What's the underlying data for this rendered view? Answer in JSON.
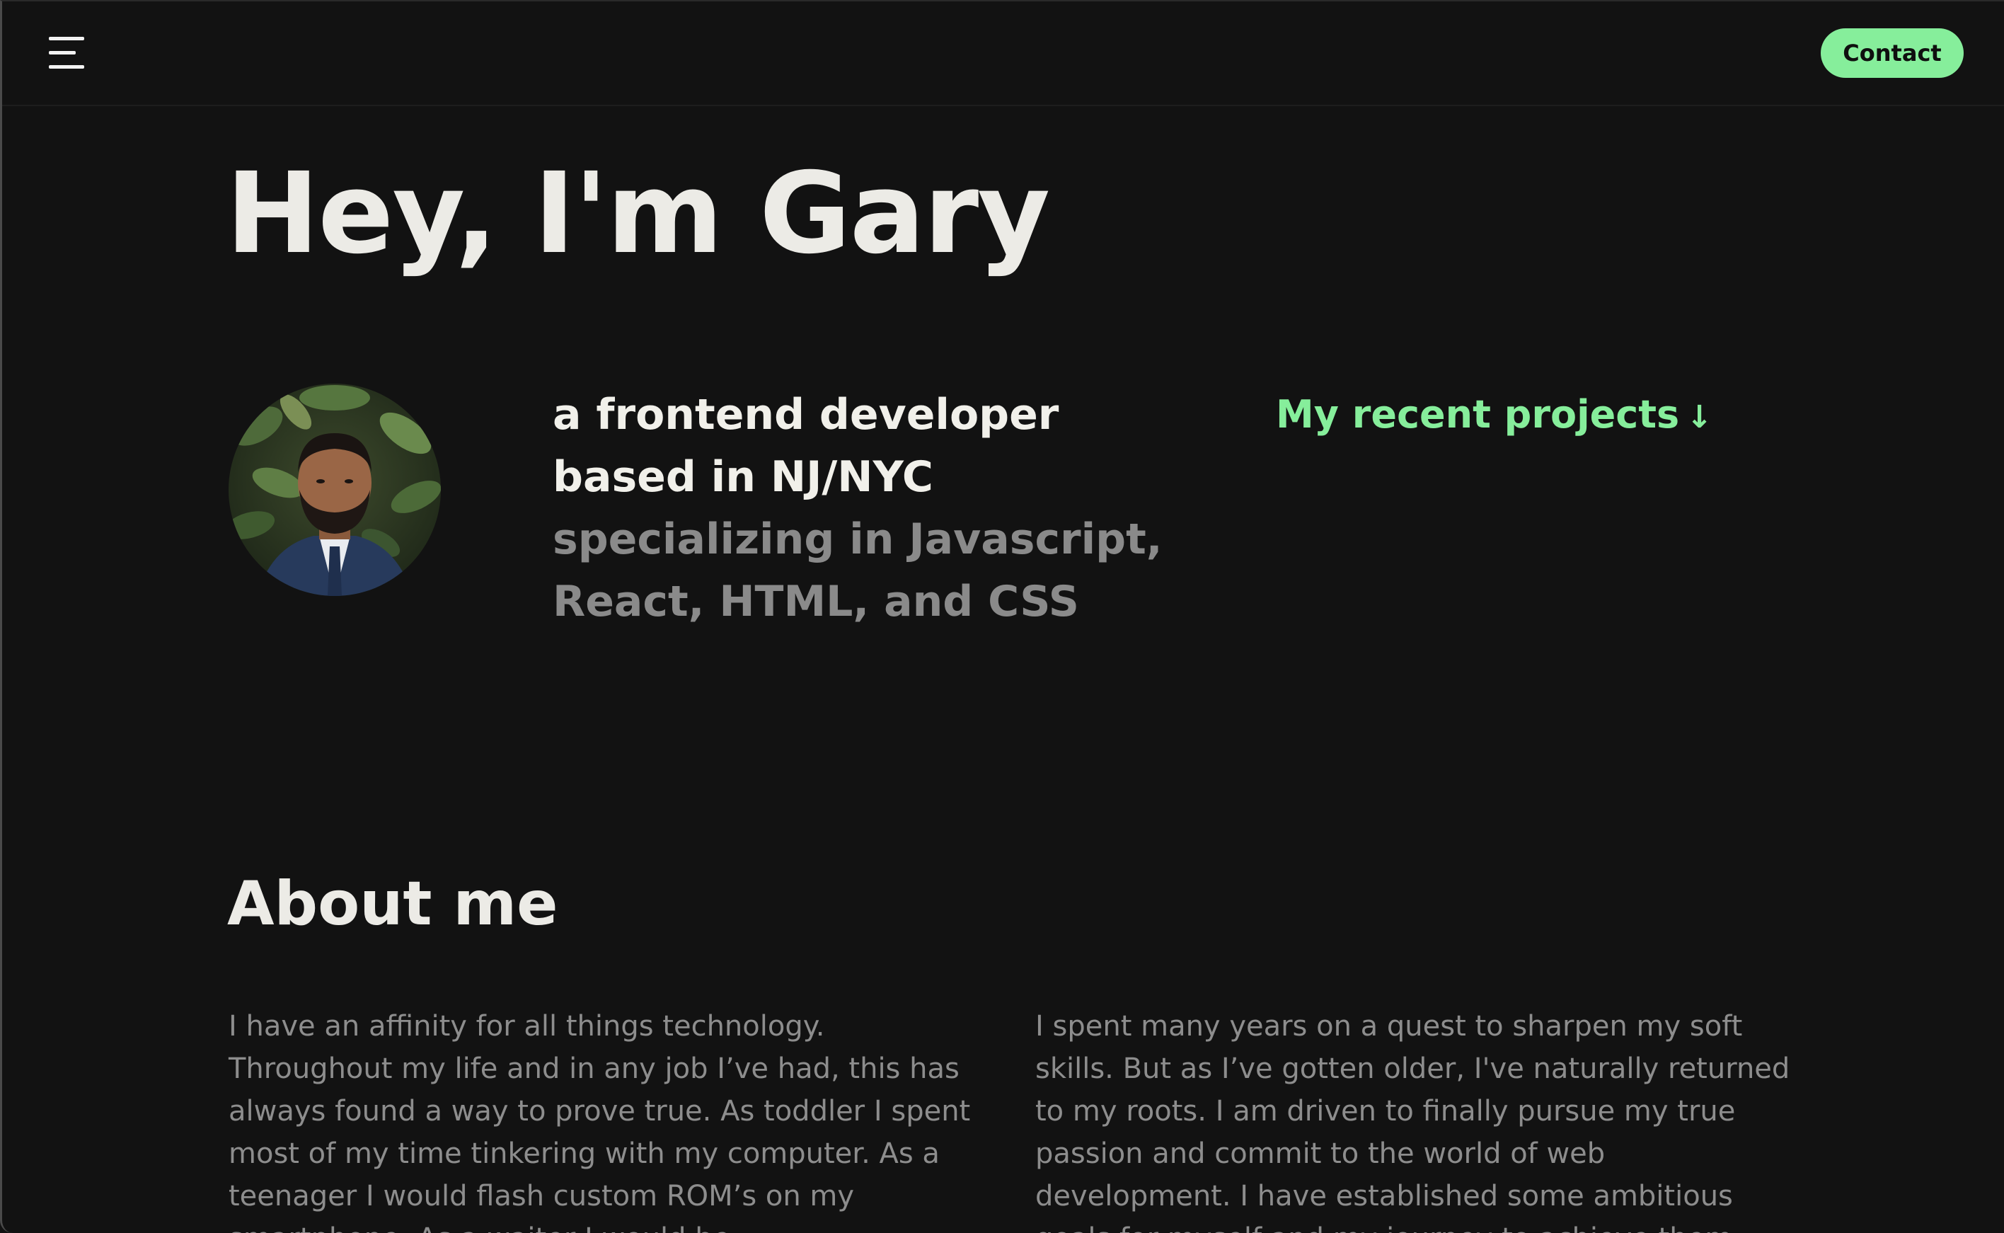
{
  "nav": {
    "menu_icon": "hamburger-menu-icon",
    "contact_label": "Contact"
  },
  "hero": {
    "title": "Hey, I'm Gary",
    "avatar_alt": "portrait-photo",
    "tagline_line1": "a frontend developer based in NJ/NYC",
    "tagline_line2": "specializing in Javascript, React, HTML, and CSS",
    "projects_link": "My recent projects",
    "projects_arrow": "↓"
  },
  "about": {
    "title": "About me",
    "paragraph_left": "I have an affinity for all things technology. Throughout my life and in any job I’ve had, this has always found a way to prove true. As toddler I spent most of my time tinkering with my computer. As a teenager I would flash custom ROM’s on my smartphone. As a waiter I would be",
    "paragraph_right": "I spent many years on a quest to sharpen my soft skills. But as I’ve gotten older, I've naturally returned to my roots. I am driven to finally pursue my true passion and commit to the world of web development. I have established some ambitious goals for myself and my journey to achieve them"
  },
  "colors": {
    "background": "#121212",
    "accent_green": "#86ee9b",
    "heading_text": "#ecebe6",
    "muted_text": "#8d8d8d"
  }
}
